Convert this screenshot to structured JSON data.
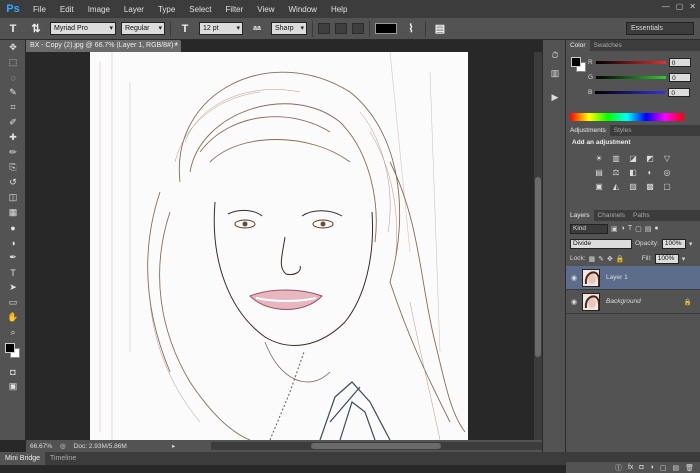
{
  "app": {
    "logo": "Ps",
    "window_controls": [
      "—",
      "▢",
      "✕"
    ]
  },
  "menu": [
    "File",
    "Edit",
    "Image",
    "Layer",
    "Type",
    "Select",
    "Filter",
    "View",
    "Window",
    "Help"
  ],
  "options": {
    "tool_icon": "T",
    "font_family": "Myriad Pro",
    "font_style": "Regular",
    "font_size": "12 pt",
    "antialias": "Sharp",
    "size_icon": "T",
    "aa_icon": "aa",
    "workspace": "Essentials",
    "text_color": "#000000"
  },
  "document": {
    "tab_title": "BX - Copy (2).jpg @ 66.7% (Layer 1, RGB/8#) *",
    "close": "×",
    "zoom": "66.67%",
    "doc_info": "Doc: 2.93M/5.86M"
  },
  "bottom_tabs": [
    "Mini Bridge",
    "Timeline"
  ],
  "tools": [
    "move-icon",
    "marquee-icon",
    "lasso-icon",
    "quick-select-icon",
    "crop-icon",
    "eyedropper-icon",
    "healing-icon",
    "brush-icon",
    "stamp-icon",
    "history-brush-icon",
    "eraser-icon",
    "gradient-icon",
    "blur-icon",
    "dodge-icon",
    "pen-icon",
    "type-icon",
    "path-select-icon",
    "shape-icon",
    "hand-icon",
    "zoom-icon"
  ],
  "tool_glyphs": [
    "✥",
    "⬚",
    "◌",
    "✎",
    "⌗",
    "✐",
    "✚",
    "✏",
    "⎘",
    "↺",
    "◫",
    "▦",
    "●",
    "◑",
    "✒",
    "T",
    "➤",
    "▭",
    "✋",
    "⌕"
  ],
  "color_panel": {
    "tabs": [
      "Color",
      "Swatches"
    ],
    "sliders": [
      {
        "label": "R",
        "value": "0",
        "color": "#d33"
      },
      {
        "label": "G",
        "value": "0",
        "color": "#3c3"
      },
      {
        "label": "B",
        "value": "0",
        "color": "#33d"
      }
    ]
  },
  "adjustments_panel": {
    "tabs": [
      "Adjustments",
      "Styles"
    ],
    "heading": "Add an adjustment",
    "icons": [
      "☀",
      "▥",
      "◪",
      "◩",
      "▽",
      "▤",
      "⚖",
      "◧",
      "◐",
      "◎",
      "▣",
      "◭",
      "▨",
      "▩",
      "▢"
    ]
  },
  "layers_panel": {
    "tabs": [
      "Layers",
      "Channels",
      "Paths"
    ],
    "kind": "Kind",
    "blend_mode": "Divide",
    "opacity_label": "Opacity:",
    "opacity": "100%",
    "lock_label": "Lock:",
    "fill_label": "Fill:",
    "fill": "100%",
    "layers": [
      {
        "name": "Layer 1",
        "selected": true
      },
      {
        "name": "Background",
        "selected": false
      }
    ],
    "footer_icons": [
      "ⓛ",
      "fx",
      "◘",
      "◑",
      "▢",
      "▤",
      "🗑"
    ]
  }
}
